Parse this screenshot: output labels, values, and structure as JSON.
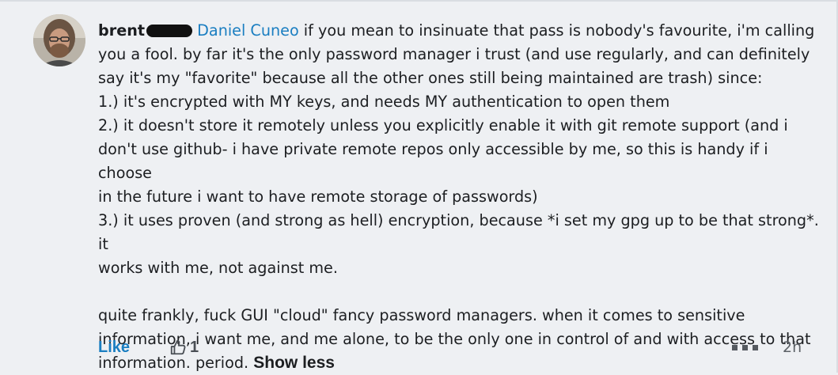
{
  "comment": {
    "author": "brent",
    "mention": "Daniel Cuneo",
    "lines": {
      "l1": " if you mean to insinuate that pass is nobody's favourite, i'm calling",
      "l2": "you a fool. by far it's the only password manager i trust (and use regularly, and can definitely",
      "l3": "say it's my \"favorite\" because all the other ones still being maintained are trash) since:",
      "l4": "1.) it's encrypted with MY keys, and needs MY authentication to open them",
      "l5": "2.) it doesn't store it remotely unless you explicitly enable it with git remote support (and i",
      "l6": "don't use github- i have private remote repos only accessible by me, so this is handy if i choose",
      "l7": "in the future i want to have remote storage of passwords)",
      "l8": "3.) it uses proven (and strong as hell) encryption, because *i set my gpg up to be that strong*. it",
      "l9": "works with me, not against me.",
      "l10": "quite frankly, fuck GUI \"cloud\" fancy password managers. when it comes to sensitive",
      "l11": "information, i want me, and me alone, to be the only one in control of and with access to that",
      "l12": "information. period. "
    },
    "show_less_label": "Show less"
  },
  "actions": {
    "like_label": "Like",
    "like_count": "1",
    "timestamp": "2h"
  },
  "colors": {
    "background": "#eef0f3",
    "link": "#1a7ec1",
    "text": "#1c1e21",
    "muted": "#5c6166"
  },
  "icons": {
    "avatar": "author-avatar-photo",
    "like_count": "thumbs-up-icon",
    "more": "more-options-icon",
    "redaction": "redaction-mark"
  }
}
